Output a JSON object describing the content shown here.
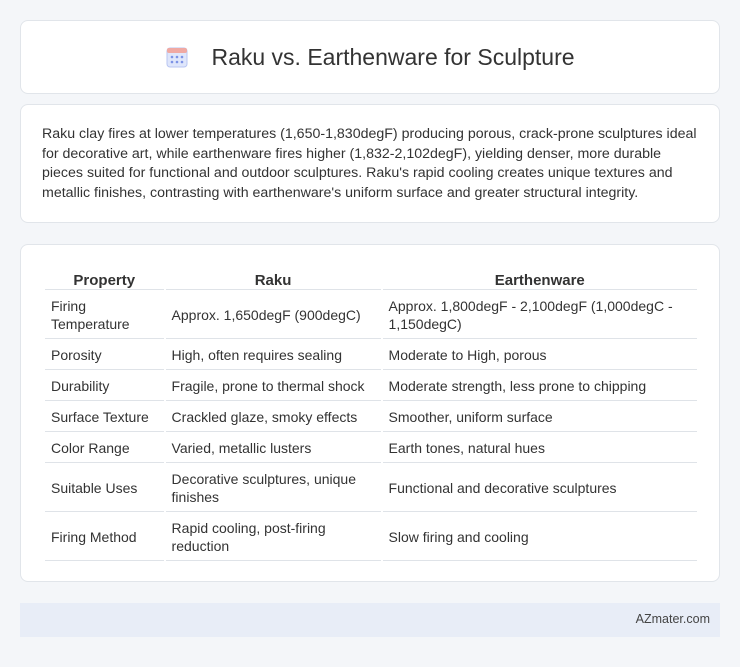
{
  "header": {
    "icon": "calendar-icon",
    "title": "Raku vs. Earthenware for Sculpture"
  },
  "summary": {
    "text": "Raku clay fires at lower temperatures (1,650-1,830degF) producing porous, crack-prone sculptures ideal for decorative art, while earthenware fires higher (1,832-2,102degF), yielding denser, more durable pieces suited for functional and outdoor sculptures. Raku's rapid cooling creates unique textures and metallic finishes, contrasting with earthenware's uniform surface and greater structural integrity."
  },
  "table": {
    "headers": [
      "Property",
      "Raku",
      "Earthenware"
    ],
    "rows": [
      [
        "Firing Temperature",
        "Approx. 1,650degF (900degC)",
        "Approx. 1,800degF - 2,100degF (1,000degC - 1,150degC)"
      ],
      [
        "Porosity",
        "High, often requires sealing",
        "Moderate to High, porous"
      ],
      [
        "Durability",
        "Fragile, prone to thermal shock",
        "Moderate strength, less prone to chipping"
      ],
      [
        "Surface Texture",
        "Crackled glaze, smoky effects",
        "Smoother, uniform surface"
      ],
      [
        "Color Range",
        "Varied, metallic lusters",
        "Earth tones, natural hues"
      ],
      [
        "Suitable Uses",
        "Decorative sculptures, unique finishes",
        "Functional and decorative sculptures"
      ],
      [
        "Firing Method",
        "Rapid cooling, post-firing reduction",
        "Slow firing and cooling"
      ]
    ]
  },
  "footer": {
    "text": "AZmater.com"
  }
}
